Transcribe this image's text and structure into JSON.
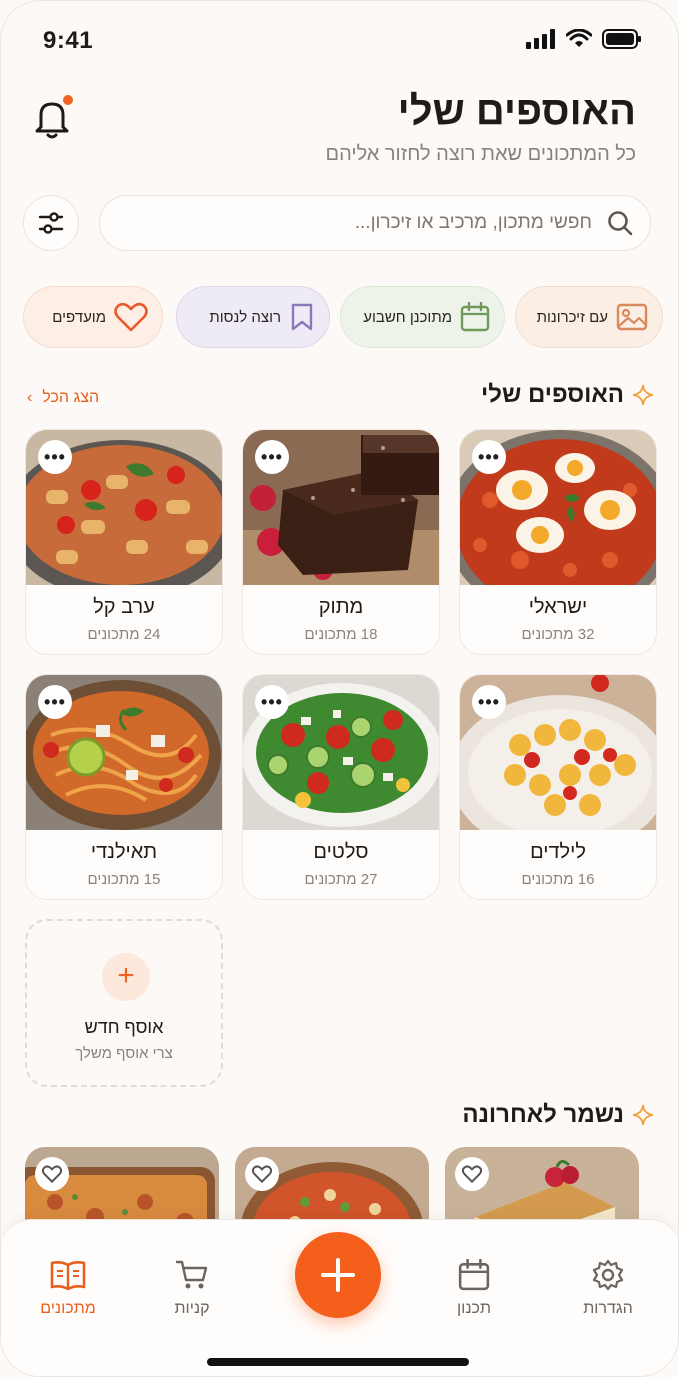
{
  "status": {
    "time": "9:41"
  },
  "header": {
    "title": "האוספים שלי",
    "subtitle": "כל המתכונים שאת רוצה לחזור אליהם"
  },
  "search": {
    "placeholder": "חפשי מתכון, מרכיב או זיכרון..."
  },
  "chips": [
    {
      "label": "עם זיכרונות",
      "icon": "image-icon",
      "bg": "#fbeee4",
      "color": "#d98a5c"
    },
    {
      "label": "מתוכנן חשבוע",
      "icon": "calendar-icon",
      "bg": "#eef3e9",
      "color": "#6f9a5a"
    },
    {
      "label": "רוצה לנסות",
      "icon": "bookmark-icon",
      "bg": "#efebf6",
      "color": "#8b78b8"
    },
    {
      "label": "מועדפים",
      "icon": "heart-icon",
      "bg": "#fdeee6",
      "color": "#ea5a2a"
    }
  ],
  "collections": {
    "title": "האוספים שלי",
    "see_all": "הצג הכל",
    "items": [
      {
        "name": "ישראלי",
        "count": "32 מתכונים",
        "photo": "shakshuka"
      },
      {
        "name": "מתוק",
        "count": "18 מתכונים",
        "photo": "brownies"
      },
      {
        "name": "ערב קל",
        "count": "24 מתכונים",
        "photo": "pasta"
      },
      {
        "name": "לילדים",
        "count": "16 מתכונים",
        "photo": "kids-pasta"
      },
      {
        "name": "סלטים",
        "count": "27 מתכונים",
        "photo": "salad"
      },
      {
        "name": "תאילנדי",
        "count": "15 מתכונים",
        "photo": "thai-noodles"
      }
    ],
    "new": {
      "title": "אוסף חדש",
      "subtitle": "צרי אוסף משלך",
      "plus": "+"
    }
  },
  "recent": {
    "title": "נשמר לאחרונה",
    "items": [
      {
        "photo": "cheesecake"
      },
      {
        "photo": "tomato-soup"
      },
      {
        "photo": "lasagna"
      }
    ]
  },
  "nav": {
    "items": [
      {
        "label": "הגדרות",
        "icon": "gear-icon"
      },
      {
        "label": "תכנון",
        "icon": "calendar-icon"
      },
      {
        "label": "קניות",
        "icon": "cart-icon"
      },
      {
        "label": "מתכונים",
        "icon": "book-icon",
        "active": true
      }
    ],
    "accent": "#f55f1c"
  }
}
